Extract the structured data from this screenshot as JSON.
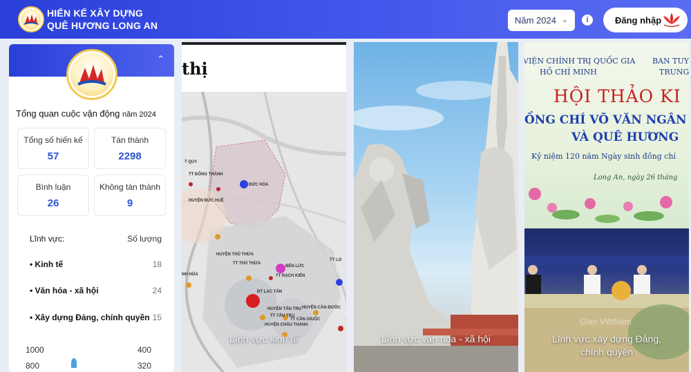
{
  "header": {
    "brand_line1": "HIẾN KẾ XÂY DỰNG",
    "brand_line2": "QUÊ HƯƠNG LONG AN",
    "year_select": "Năm 2024",
    "info": "i",
    "login": "Đăng nhập"
  },
  "sidebar": {
    "overview_title": "Tổng quan cuộc vận động",
    "overview_year": "năm 2024",
    "stats": [
      {
        "label": "Tổng số hiến kế",
        "value": "57"
      },
      {
        "label": "Tán thành",
        "value": "2298"
      },
      {
        "label": "Bình luận",
        "value": "26"
      },
      {
        "label": "Không tán thành",
        "value": "9"
      }
    ],
    "field_header": "Lĩnh vực:",
    "count_header": "Số lượng",
    "fields": [
      {
        "label": "• Kinh tế",
        "count": "18"
      },
      {
        "label": "• Văn hóa - xã hội",
        "count": "24"
      },
      {
        "label": "• Xây dựng Đảng, chính quyền",
        "count": "15"
      }
    ],
    "chart_axis_left": [
      "1000",
      "800"
    ],
    "chart_axis_right": [
      "400",
      "320"
    ]
  },
  "cards": [
    {
      "label": "Lĩnh vực kinh tế",
      "title_word": "thị",
      "map_labels": [
        "T QUY",
        "TT ĐÔNG THÀNH",
        "ĐỨC HÒA",
        "HUYỆN ĐỨC HUỆ",
        "HUYỆN THỦ THỪA",
        "TT THỦ THỪA",
        "BẾN LỨC",
        "TT RẠCH KIẾN",
        "TT LO",
        "NH HÓA",
        "ĐT LẠC TẤN",
        "HUYỆN TÂN TRỤ",
        "TT TÂN TRỤ",
        "HUYỆN CHÂU THÀNH",
        "TT CẦN GIUỘC",
        "HUYỆN CẦN ĐƯỚC"
      ]
    },
    {
      "label": "Lĩnh vực văn hóa - xã hội"
    },
    {
      "label_line1": "Lĩnh vực xây dựng Đảng,",
      "label_line2": "chính quyền",
      "banner_left1": "VIỆN CHÍNH TRỊ QUỐC GIA",
      "banner_left2": "HỒ CHÍ MINH",
      "banner_right1": "BAN TUY",
      "banner_right2": "TRUNG",
      "banner_title": "HỘI THẢO KI",
      "banner_sub1": "ỒNG CHÍ VÕ VĂN NGÂN VỚI",
      "banner_sub2": "VÀ QUÊ HƯƠNG",
      "banner_sub3": "Kỷ niệm 120 năm Ngày sinh đồng chí",
      "banner_date": "Long An, ngày 26 tháng",
      "watermark": "Giao ViệtNam"
    }
  ],
  "colors": {
    "header_start": "#2a3fd8",
    "header_end": "#5a6cf2",
    "stat_value": "#2b55d6"
  }
}
